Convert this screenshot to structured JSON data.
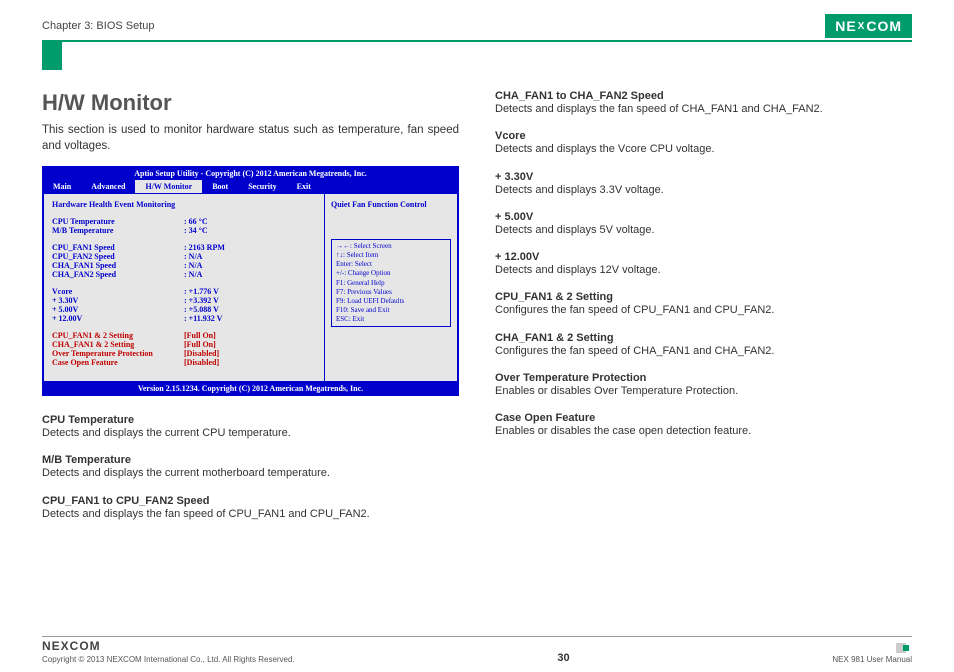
{
  "header": {
    "chapter": "Chapter 3: BIOS Setup",
    "brand_left": "NE",
    "brand_mid": "X",
    "brand_right": "COM"
  },
  "left": {
    "title": "H/W Monitor",
    "intro": "This section is used to monitor hardware status such as temperature, fan speed and voltages."
  },
  "bios": {
    "title": "Aptio Setup Utility - Copyright (C) 2012 American Megatrends, Inc.",
    "tabs": [
      "Main",
      "Advanced",
      "H/W Monitor",
      "Boot",
      "Security",
      "Exit"
    ],
    "active_tab": "H/W Monitor",
    "heading": "Hardware Health Event Monitoring",
    "side_note": "Quiet Fan Function Control",
    "rows": [
      {
        "label": "CPU Temperature",
        "value": ":  66 °C"
      },
      {
        "label": "M/B Temperature",
        "value": ":  34 °C"
      }
    ],
    "fan_rows": [
      {
        "label": "CPU_FAN1 Speed",
        "value": ":  2163 RPM"
      },
      {
        "label": "CPU_FAN2 Speed",
        "value": ":  N/A"
      },
      {
        "label": "CHA_FAN1 Speed",
        "value": ":  N/A"
      },
      {
        "label": "CHA_FAN2 Speed",
        "value": ":  N/A"
      }
    ],
    "volt_rows": [
      {
        "label": "Vcore",
        "value": ":  +1.776 V"
      },
      {
        "label": "+ 3.30V",
        "value": ":  +3.392 V"
      },
      {
        "label": "+ 5.00V",
        "value": ":  +5.088 V"
      },
      {
        "label": "+ 12.00V",
        "value": ":  +11.932 V"
      }
    ],
    "opt_rows": [
      {
        "label": "CPU_FAN1 & 2 Setting",
        "value": "[Full On]"
      },
      {
        "label": "CHA_FAN1 & 2 Setting",
        "value": "[Full On]"
      },
      {
        "label": "Over Temperature Protection",
        "value": "[Disabled]"
      },
      {
        "label": "Case Open Feature",
        "value": "[Disabled]"
      }
    ],
    "hints": [
      "→←: Select Screen",
      "↑↓: Select Item",
      "Enter: Select",
      "+/-: Change Option",
      "F1: General Help",
      "F7: Previous Values",
      "F9: Load UEFI Defaults",
      "F10: Save and Exit",
      "ESC: Exit"
    ],
    "footer": "Version 2.15.1234. Copyright (C) 2012 American Megatrends, Inc."
  },
  "left_desc": [
    {
      "t": "CPU Temperature",
      "d": "Detects and displays the current CPU temperature."
    },
    {
      "t": "M/B Temperature",
      "d": "Detects and displays the current motherboard temperature."
    },
    {
      "t": "CPU_FAN1 to CPU_FAN2 Speed",
      "d": "Detects and displays the fan speed of CPU_FAN1 and CPU_FAN2."
    }
  ],
  "right_desc": [
    {
      "t": "CHA_FAN1 to CHA_FAN2 Speed",
      "d": "Detects and displays the fan speed of CHA_FAN1 and CHA_FAN2."
    },
    {
      "t": "Vcore",
      "d": "Detects and displays the Vcore CPU voltage."
    },
    {
      "t": "+ 3.30V",
      "d": "Detects and displays 3.3V voltage."
    },
    {
      "t": "+ 5.00V",
      "d": "Detects and displays 5V voltage."
    },
    {
      "t": "+ 12.00V",
      "d": "Detects and displays 12V voltage."
    },
    {
      "t": "CPU_FAN1 & 2 Setting",
      "d": "Configures the fan speed of CPU_FAN1 and CPU_FAN2."
    },
    {
      "t": "CHA_FAN1 & 2 Setting",
      "d": "Configures the fan speed of CHA_FAN1 and CHA_FAN2."
    },
    {
      "t": "Over Temperature Protection",
      "d": "Enables or disables Over Temperature Protection."
    },
    {
      "t": "Case Open Feature",
      "d": "Enables or disables the case open detection feature."
    }
  ],
  "footer": {
    "brand": "NEXCOM",
    "copyright": "Copyright © 2013 NEXCOM International Co., Ltd. All Rights Reserved.",
    "page": "30",
    "manual": "NEX 981 User Manual"
  }
}
